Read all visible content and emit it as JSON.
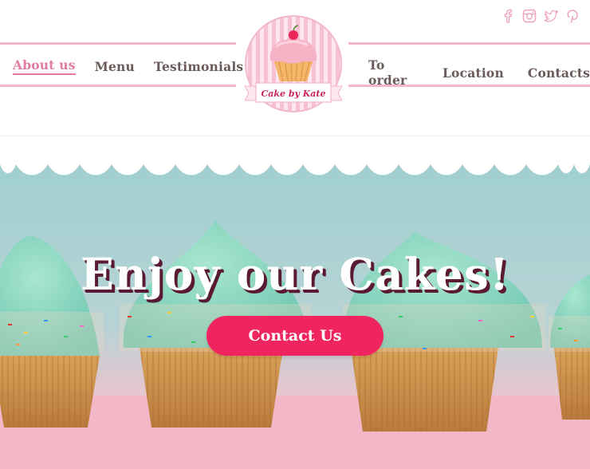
{
  "social": [
    {
      "name": "facebook-icon"
    },
    {
      "name": "instagram-icon"
    },
    {
      "name": "twitter-icon"
    },
    {
      "name": "pinterest-icon"
    }
  ],
  "nav": {
    "left": [
      {
        "label": "About us",
        "active": true
      },
      {
        "label": "Menu",
        "active": false
      },
      {
        "label": "Testimonials",
        "active": false
      }
    ],
    "right": [
      {
        "label": "To order",
        "active": false
      },
      {
        "label": "Location",
        "active": false
      },
      {
        "label": "Contacts",
        "active": false
      }
    ]
  },
  "logo": {
    "text": "Cake by Kate"
  },
  "hero": {
    "title": "Enjoy our Cakes!",
    "cta_label": "Contact Us"
  },
  "colors": {
    "accent_pink": "#e27aa3",
    "stripe_pink": "#f3b6cc",
    "cta": "#f0245f",
    "nav_text": "#6a5a5a",
    "hero_bg": "#a9cfd0"
  }
}
